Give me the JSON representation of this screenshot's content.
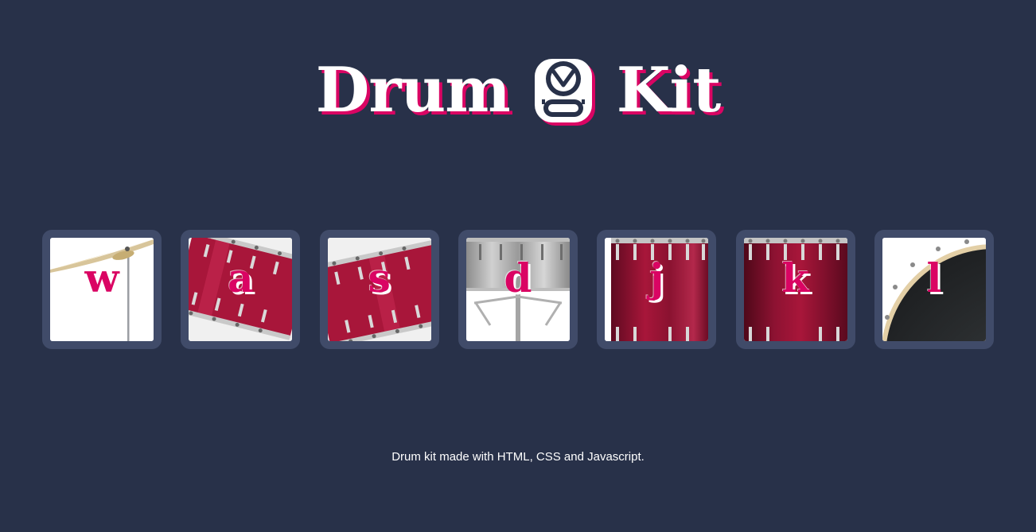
{
  "header": {
    "title_left": "Drum",
    "title_right": "Kit",
    "logo_icon": "drum-logo-icon"
  },
  "keys": [
    {
      "letter": "w",
      "icon": "cymbal-icon"
    },
    {
      "letter": "a",
      "icon": "red-tom-icon"
    },
    {
      "letter": "s",
      "icon": "red-tom-icon"
    },
    {
      "letter": "d",
      "icon": "snare-drum-icon"
    },
    {
      "letter": "j",
      "icon": "floor-tom-icon"
    },
    {
      "letter": "k",
      "icon": "floor-tom-icon"
    },
    {
      "letter": "l",
      "icon": "bass-drum-icon"
    }
  ],
  "footer": {
    "text": "Drum kit made with HTML, CSS and Javascript."
  },
  "colors": {
    "background": "#283149",
    "key_border": "#404b69",
    "accent": "#da0463",
    "drum_red": "#a8163a",
    "white": "#ffffff"
  }
}
